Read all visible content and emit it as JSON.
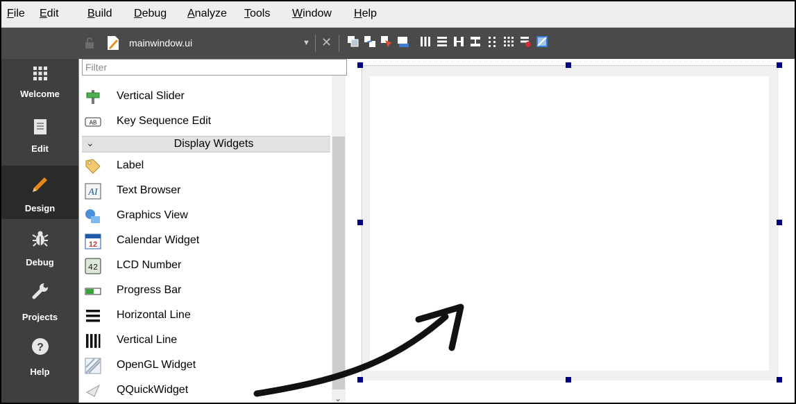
{
  "menu": {
    "items": [
      {
        "mnemonic": "F",
        "rest": "ile"
      },
      {
        "mnemonic": "E",
        "rest": "dit"
      },
      {
        "mnemonic": "B",
        "rest": "uild"
      },
      {
        "mnemonic": "D",
        "rest": "ebug"
      },
      {
        "mnemonic": "A",
        "rest": "nalyze"
      },
      {
        "mnemonic": "T",
        "rest": "ools"
      },
      {
        "mnemonic": "W",
        "rest": "indow"
      },
      {
        "mnemonic": "H",
        "rest": "elp"
      }
    ]
  },
  "toolbar": {
    "filename": "mainwindow.ui",
    "icons": [
      "edit-widgets-icon",
      "edit-signals-slots-icon",
      "edit-buddies-icon",
      "edit-tab-order-icon",
      "layout-horizontal-icon",
      "layout-vertical-icon",
      "layout-horizontal-splitter-icon",
      "layout-vertical-splitter-icon",
      "layout-form-icon",
      "layout-grid-icon",
      "break-layout-icon",
      "adjust-size-icon"
    ]
  },
  "modes": [
    {
      "label": "Welcome",
      "icon": "grid-icon"
    },
    {
      "label": "Edit",
      "icon": "document-icon"
    },
    {
      "label": "Design",
      "icon": "pencil-icon",
      "active": true
    },
    {
      "label": "Debug",
      "icon": "bug-icon"
    },
    {
      "label": "Projects",
      "icon": "wrench-icon"
    },
    {
      "label": "Help",
      "icon": "question-icon"
    }
  ],
  "widget_box": {
    "filter_placeholder": "Filter",
    "items_before": [
      {
        "label": "Vertical Slider",
        "icon": "vertical-slider-icon"
      },
      {
        "label": "Key Sequence Edit",
        "icon": "key-sequence-edit-icon"
      }
    ],
    "section": "Display Widgets",
    "items": [
      {
        "label": "Label",
        "icon": "label-tag-icon"
      },
      {
        "label": "Text Browser",
        "icon": "text-browser-icon"
      },
      {
        "label": "Graphics View",
        "icon": "graphics-view-icon"
      },
      {
        "label": "Calendar Widget",
        "icon": "calendar-icon"
      },
      {
        "label": "LCD Number",
        "icon": "lcd-number-icon"
      },
      {
        "label": "Progress Bar",
        "icon": "progress-bar-icon"
      },
      {
        "label": "Horizontal Line",
        "icon": "horizontal-line-icon"
      },
      {
        "label": "Vertical Line",
        "icon": "vertical-line-icon"
      },
      {
        "label": "OpenGL Widget",
        "icon": "opengl-widget-icon"
      },
      {
        "label": "QQuickWidget",
        "icon": "qquickwidget-icon"
      }
    ],
    "calendar_day": "12",
    "lcd_digits": "42",
    "text_browser_glyph": "AI"
  },
  "colors": {
    "toolbar_bg": "#4a4a4a",
    "modebar_bg": "#3f3f3f",
    "design_accent": "#e8891c",
    "selection_handle": "#00007f"
  }
}
